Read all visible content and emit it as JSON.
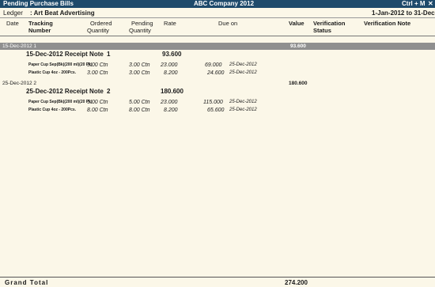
{
  "window": {
    "title": "Pending Purchase Bills",
    "company": "ABC Company 2012",
    "shortcut": "Ctrl + M",
    "close": "✕"
  },
  "ledger": {
    "label": "Ledger",
    "value": ": Art Beat Advertising",
    "period": "1-Jan-2012 to 31-Dec-2012"
  },
  "columns": {
    "date": "Date",
    "tracking1": "Tracking",
    "tracking2": "Number",
    "ordered1": "Ordered",
    "ordered2": "Quantity",
    "pending1": "Pending",
    "pending2": "Quantity",
    "rate": "Rate",
    "due": "Due on",
    "value": "Value",
    "vstatus1": "Verification",
    "vstatus2": "Status",
    "vnote": "Verification Note"
  },
  "groups": [
    {
      "date_label": "15-Dec-2012 1",
      "value": "93.600",
      "voucher": {
        "title": "15-Dec-2012 Receipt Note",
        "number": "1",
        "amount": "93.600"
      },
      "items": [
        {
          "name": "Paper Cup Sep(Bk)(200 ml)(20 Pk)",
          "ordered": "3.00 Ctn",
          "pending": "3.00 Ctn",
          "rate": "23.000",
          "amount": "69.000",
          "due": "25-Dec-2012"
        },
        {
          "name": "Plastic Cup 4oz - 200Pcs.",
          "ordered": "3.00 Ctn",
          "pending": "3.00 Ctn",
          "rate": "8.200",
          "amount": "24.600",
          "due": "25-Dec-2012"
        }
      ]
    },
    {
      "date_label": "25-Dec-2012 2",
      "value": "180.600",
      "voucher": {
        "title": "25-Dec-2012 Receipt Note",
        "number": "2",
        "amount": "180.600"
      },
      "items": [
        {
          "name": "Paper Cup Sep(Bk)(200 ml)(20 Pk)",
          "ordered": "5.00 Ctn",
          "pending": "5.00 Ctn",
          "rate": "23.000",
          "amount": "115.000",
          "due": "25-Dec-2012"
        },
        {
          "name": "Plastic Cup 4oz - 200Pcs.",
          "ordered": "8.00 Ctn",
          "pending": "8.00 Ctn",
          "rate": "8.200",
          "amount": "65.600",
          "due": "25-Dec-2012"
        }
      ]
    }
  ],
  "total": {
    "label": "Grand Total",
    "value": "274.200"
  },
  "colors": {
    "titlebar": "#1e4a6b",
    "background": "#fbf7e8",
    "selected_row": "#8f8f8f"
  }
}
